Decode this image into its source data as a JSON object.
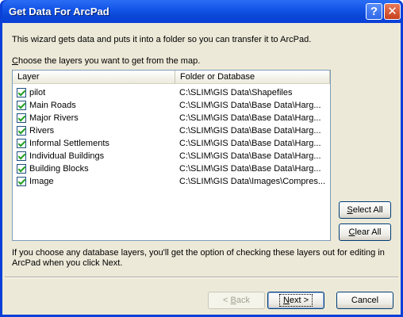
{
  "window": {
    "title": "Get Data For ArcPad"
  },
  "titlebar": {
    "help_glyph": "?",
    "close_glyph": "✕"
  },
  "intro_text": "This wizard gets data and puts it into a folder so you can transfer it to ArcPad.",
  "choose_label": {
    "mnemonic": "C",
    "rest": "hoose the layers you want to get from the map."
  },
  "layers_table": {
    "columns": [
      "Layer",
      "Folder or Database"
    ],
    "rows": [
      {
        "layer": "pilot",
        "path": "C:\\SLIM\\GIS Data\\Shapefiles",
        "checked": true
      },
      {
        "layer": "Main Roads",
        "path": "C:\\SLIM\\GIS Data\\Base Data\\Harg...",
        "checked": true
      },
      {
        "layer": "Major Rivers",
        "path": "C:\\SLIM\\GIS Data\\Base Data\\Harg...",
        "checked": true
      },
      {
        "layer": "Rivers",
        "path": "C:\\SLIM\\GIS Data\\Base Data\\Harg...",
        "checked": true
      },
      {
        "layer": "Informal Settlements",
        "path": "C:\\SLIM\\GIS Data\\Base Data\\Harg...",
        "checked": true
      },
      {
        "layer": "Individual Buildings",
        "path": "C:\\SLIM\\GIS Data\\Base Data\\Harg...",
        "checked": true
      },
      {
        "layer": "Building Blocks",
        "path": "C:\\SLIM\\GIS Data\\Base Data\\Harg...",
        "checked": true
      },
      {
        "layer": "Image",
        "path": "C:\\SLIM\\GIS Data\\Images\\Compres...",
        "checked": true
      }
    ]
  },
  "buttons": {
    "select_all": {
      "mnemonic": "S",
      "rest": "elect All"
    },
    "clear_all": {
      "mnemonic": "C",
      "rest": "lear All"
    },
    "back": {
      "prefix": "< ",
      "mnemonic": "B",
      "rest": "ack"
    },
    "next": {
      "mnemonic": "N",
      "rest": "ext >"
    },
    "cancel": "Cancel"
  },
  "footer_note": {
    "line1": "If you choose any database layers, you'll get the option of checking these layers out for editing in",
    "line2": "ArcPad when you click Next."
  }
}
